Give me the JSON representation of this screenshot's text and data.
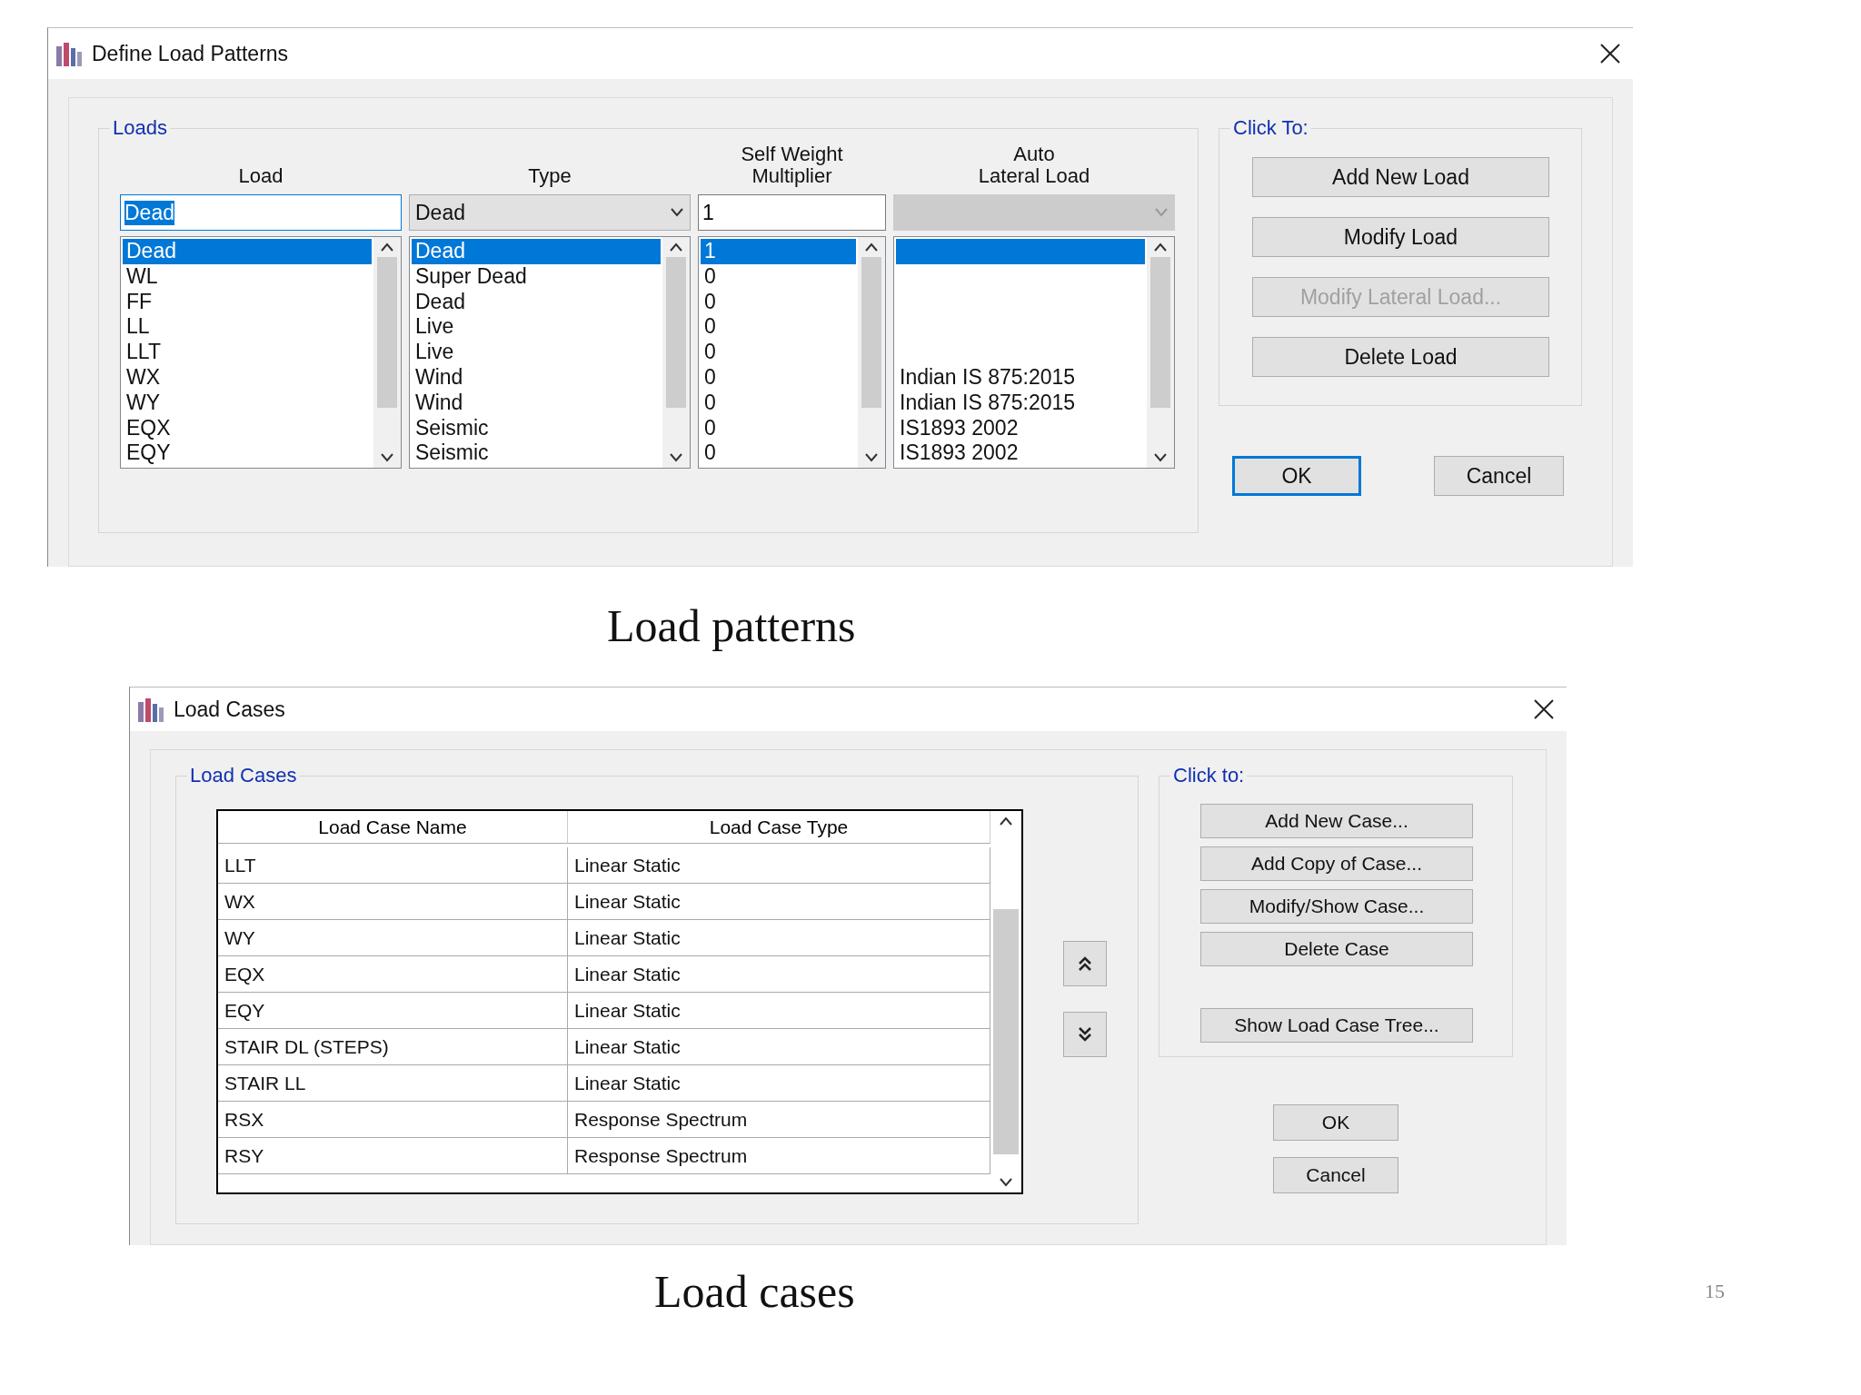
{
  "patterns": {
    "title": "Define Load Patterns",
    "group": "Loads",
    "headers": {
      "load": [
        "Load"
      ],
      "type": [
        "Type"
      ],
      "multiplier": [
        "Self Weight",
        "Multiplier"
      ],
      "lateral": [
        "Auto",
        "Lateral Load"
      ]
    },
    "edit": {
      "load": "Dead",
      "type": "Dead",
      "multiplier": "1",
      "lateral_disabled": true
    },
    "rows": [
      {
        "load": "Dead",
        "type": "Dead",
        "multiplier": "1",
        "selected": true
      },
      {
        "load": "WL",
        "type": "Super Dead",
        "multiplier": "0",
        "selected": false
      },
      {
        "load": "FF",
        "type": "Dead",
        "multiplier": "0",
        "selected": false
      },
      {
        "load": "LL",
        "type": "Live",
        "multiplier": "0",
        "selected": false
      },
      {
        "load": "LLT",
        "type": "Live",
        "multiplier": "0",
        "selected": false
      },
      {
        "load": "WX",
        "type": "Wind",
        "multiplier": "0",
        "lateral": "Indian IS 875:2015",
        "selected": false
      },
      {
        "load": "WY",
        "type": "Wind",
        "multiplier": "0",
        "lateral": "Indian IS 875:2015",
        "selected": false
      },
      {
        "load": "EQX",
        "type": "Seismic",
        "multiplier": "0",
        "lateral": "IS1893 2002",
        "selected": false
      },
      {
        "load": "EQY",
        "type": "Seismic",
        "multiplier": "0",
        "lateral": "IS1893 2002",
        "selected": false
      }
    ],
    "click_to": {
      "label": "Click To:",
      "buttons": [
        {
          "label": "Add New Load",
          "disabled": false
        },
        {
          "label": "Modify Load",
          "disabled": false
        },
        {
          "label": "Modify Lateral Load...",
          "disabled": true
        },
        {
          "label": "Delete Load",
          "disabled": false
        }
      ]
    },
    "ok": "OK",
    "cancel": "Cancel"
  },
  "caption_1": "Load patterns",
  "cases": {
    "title": "Load Cases",
    "group": "Load Cases",
    "columns": [
      "Load Case Name",
      "Load Case Type"
    ],
    "rows": [
      [
        "LLT",
        "Linear Static"
      ],
      [
        "WX",
        "Linear Static"
      ],
      [
        "WY",
        "Linear Static"
      ],
      [
        "EQX",
        "Linear Static"
      ],
      [
        "EQY",
        "Linear Static"
      ],
      [
        "STAIR DL (STEPS)",
        "Linear Static"
      ],
      [
        "STAIR LL",
        "Linear Static"
      ],
      [
        "RSX",
        "Response Spectrum"
      ],
      [
        "RSY",
        "Response Spectrum"
      ]
    ],
    "click_to": {
      "label": "Click to:",
      "buttons": [
        "Add New Case...",
        "Add Copy of Case...",
        "Modify/Show Case...",
        "Delete Case"
      ],
      "tree_button": "Show Load Case Tree..."
    },
    "ok": "OK",
    "cancel": "Cancel"
  },
  "caption_2": "Load cases",
  "page_number": "15"
}
